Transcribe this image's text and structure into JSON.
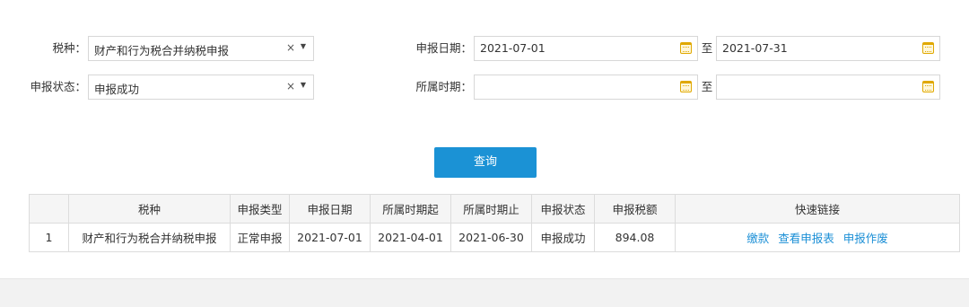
{
  "filters": {
    "tax_type": {
      "label": "税种：",
      "value": "财产和行为税合并纳税申报",
      "clear": "×",
      "caret": "▼"
    },
    "status": {
      "label": "申报状态：",
      "value": "申报成功",
      "clear": "×",
      "caret": "▼"
    },
    "declare_date": {
      "label": "申报日期：",
      "from": "2021-07-01",
      "sep": "至",
      "to": "2021-07-31"
    },
    "period": {
      "label": "所属时期：",
      "from": "",
      "sep": "至",
      "to": ""
    }
  },
  "query_button": "查询",
  "table": {
    "headers": [
      "",
      "税种",
      "申报类型",
      "申报日期",
      "所属时期起",
      "所属时期止",
      "申报状态",
      "申报税额",
      "快速链接"
    ],
    "rows": [
      {
        "index": "1",
        "tax_type": "财产和行为税合并纳税申报",
        "declare_type": "正常申报",
        "declare_date": "2021-07-01",
        "period_start": "2021-04-01",
        "period_end": "2021-06-30",
        "status": "申报成功",
        "amount": "894.08",
        "links": [
          "缴款",
          "查看申报表",
          "申报作废"
        ]
      }
    ]
  },
  "colors": {
    "accent": "#1b92d5",
    "link": "#1b8fd6",
    "calendar": "#e0a800"
  }
}
